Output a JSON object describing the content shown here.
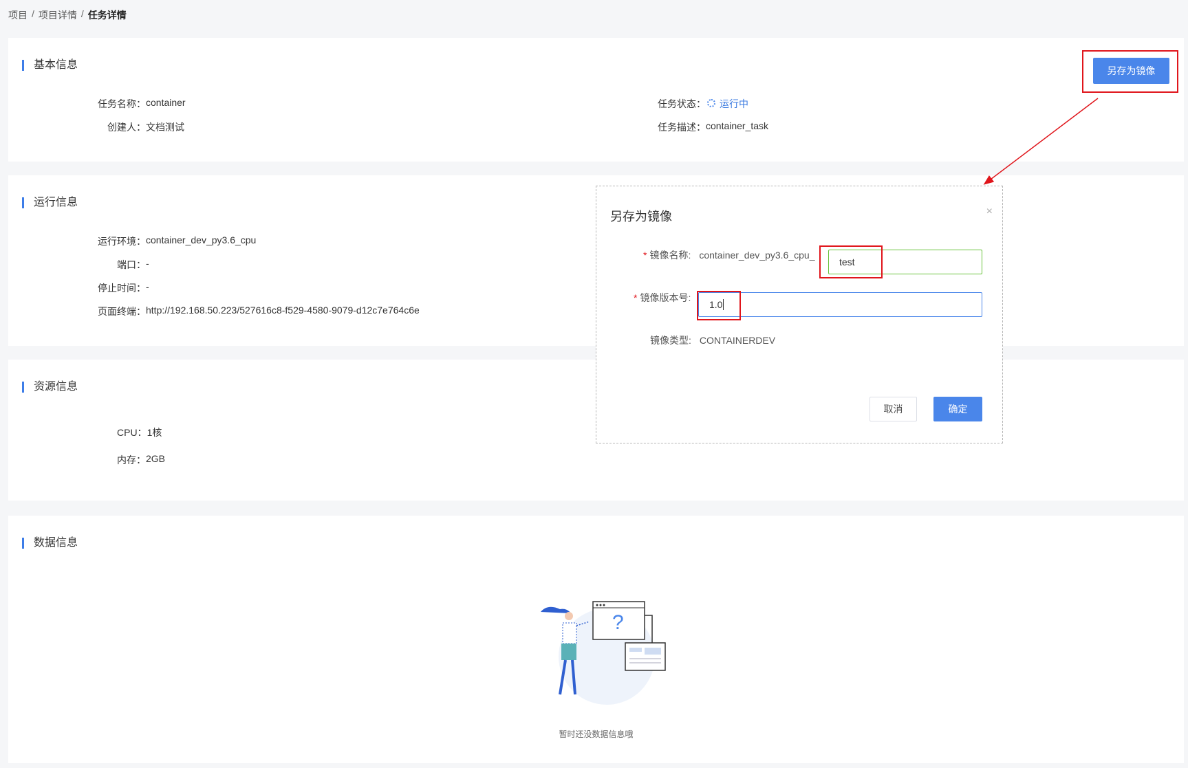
{
  "breadcrumb": {
    "items": [
      "项目",
      "项目详情"
    ],
    "current": "任务详情",
    "separator": "/"
  },
  "basic": {
    "title": "基本信息",
    "task_name_label": "任务名称：",
    "task_name": "container",
    "creator_label": "创建人：",
    "creator": "文档测试",
    "status_label": "任务状态：",
    "status": "运行中",
    "desc_label": "任务描述：",
    "desc": "container_task",
    "save_image_button": "另存为镜像"
  },
  "runtime": {
    "title": "运行信息",
    "env_label": "运行环境：",
    "env": "container_dev_py3.6_cpu",
    "port_label": "端口：",
    "port": "-",
    "stop_label": "停止时间：",
    "stop": "-",
    "terminal_label": "页面终端：",
    "terminal": "http://192.168.50.223/527616c8-f529-4580-9079-d12c7e764c6e"
  },
  "resource": {
    "title": "资源信息",
    "cpu_label": "CPU：",
    "cpu": "1核",
    "mem_label": "内存：",
    "mem": "2GB"
  },
  "data_info": {
    "title": "数据信息",
    "empty_text": "暂时还没数据信息哦"
  },
  "modal": {
    "title": "另存为镜像",
    "close": "×",
    "name_label": "镜像名称:",
    "name_prefix": "container_dev_py3.6_cpu_",
    "name_value": "test",
    "version_label": "镜像版本号:",
    "version_value": "1.0",
    "type_label": "镜像类型:",
    "type_value": "CONTAINERDEV",
    "cancel": "取消",
    "confirm": "确定",
    "required_mark": "*"
  },
  "colors": {
    "accent": "#4a86ea",
    "annotation": "#e0151b",
    "valid": "#67c23a"
  }
}
